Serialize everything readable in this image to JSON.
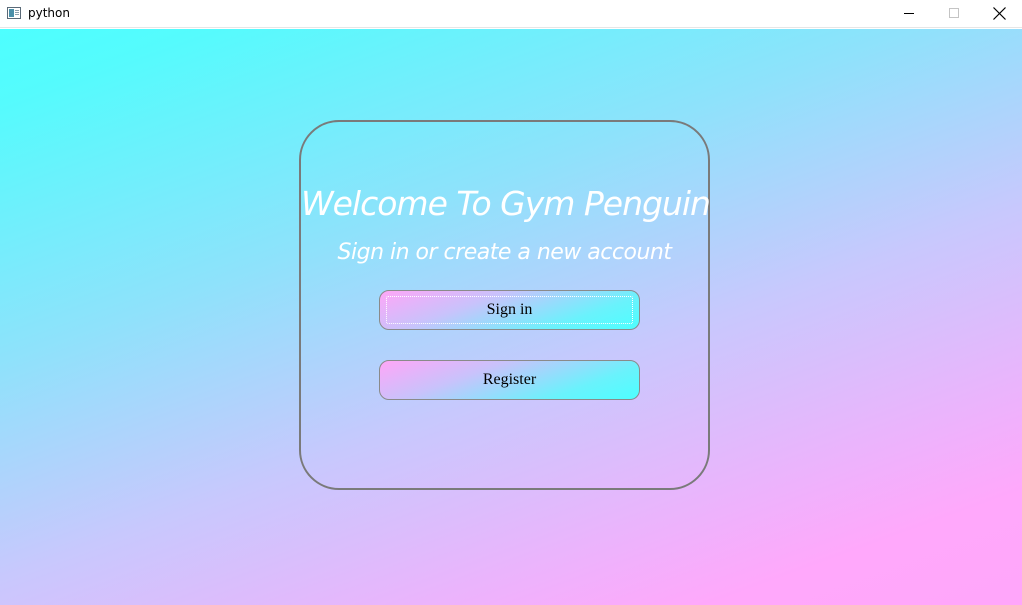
{
  "window": {
    "title": "python"
  },
  "card": {
    "title": "Welcome To Gym Penguin",
    "subtitle": "Sign in or create a new account"
  },
  "buttons": {
    "sign_in": "Sign in",
    "register": "Register"
  },
  "icons": {
    "app": "app-window-icon",
    "minimize": "minimize-icon",
    "maximize": "maximize-icon",
    "close": "close-icon"
  },
  "colors": {
    "gradient_start": "#4dffff",
    "gradient_end": "#ffa6fa",
    "text_white": "#ffffff",
    "border_gray": "#7a7a7a"
  }
}
